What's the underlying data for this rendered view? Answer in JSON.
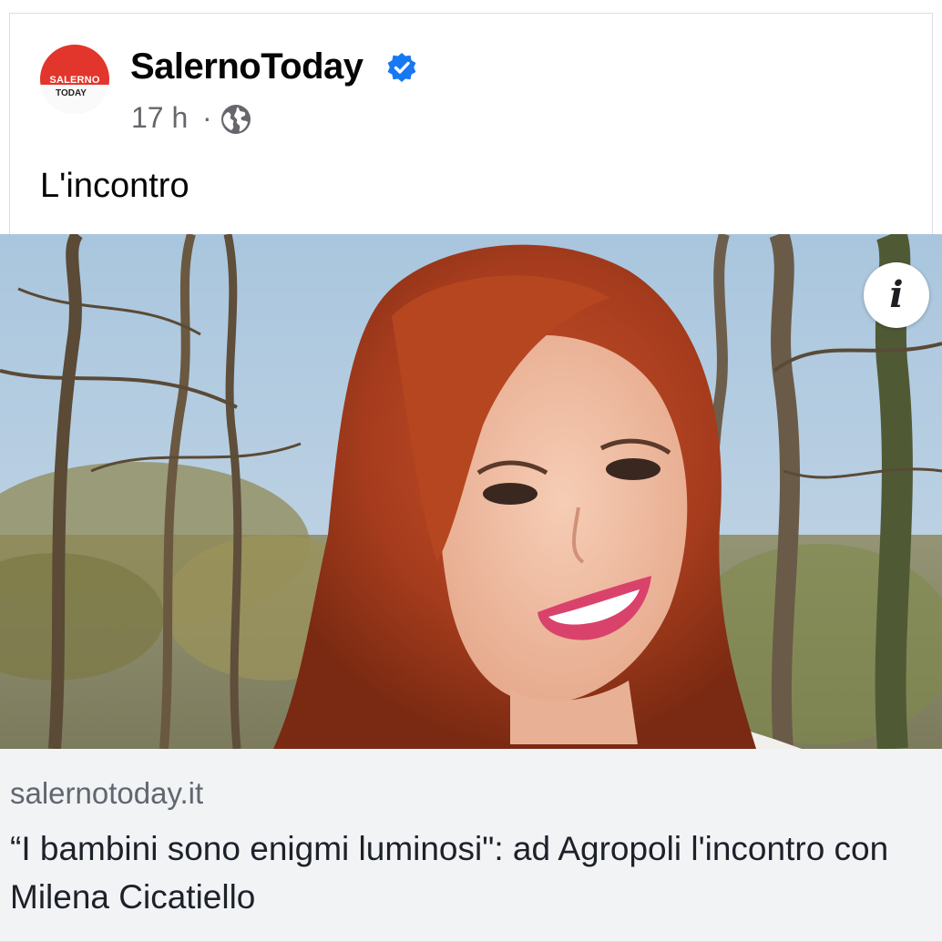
{
  "post": {
    "page_name": "SalernoToday",
    "verified": true,
    "timestamp": "17 h",
    "separator": "·",
    "audience_icon": "globe-icon",
    "caption": "L'incontro"
  },
  "avatar": {
    "line1": "SALERNO",
    "line2": "TODAY"
  },
  "photo": {
    "info_glyph": "i",
    "info_icon": "info-icon"
  },
  "link_preview": {
    "domain": "salernotoday.it",
    "title": "“I bambini sono enigmi luminosi\": ad Agropoli l'incontro con Milena Cicatiello"
  },
  "colors": {
    "verified_blue": "#1877f2",
    "brand_red": "#e2352b",
    "meta_gray": "#65676b",
    "link_box_bg": "#f2f3f5"
  }
}
